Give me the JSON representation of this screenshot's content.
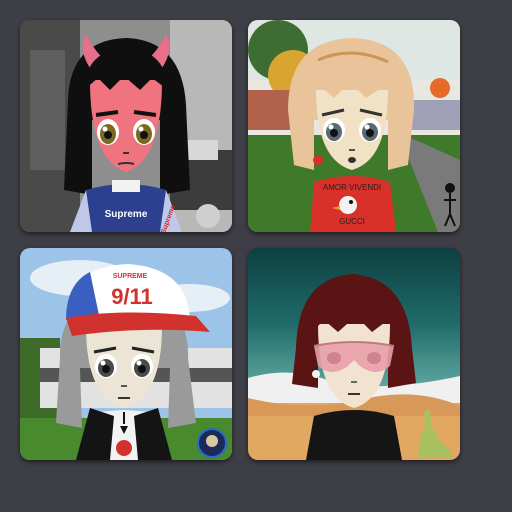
{
  "gallery": {
    "cards": [
      {
        "shirt_text": "Supreme",
        "sleeve_text": "Supreme",
        "palette": {
          "skin": "#f07480",
          "hair": "#0f0f0f",
          "horn": "#e86f8a",
          "eye": "#7a6a20",
          "shirt": "#2d3f8f",
          "background": "#9a9a9a"
        }
      },
      {
        "shirt_text": "AMOR VIVENDI",
        "shirt_sub": "GUCCI",
        "palette": {
          "skin": "#f1e2c6",
          "hair": "#e9c39a",
          "shirt": "#d9312a",
          "grass": "#3e7a2a",
          "sky": "#e8e8e0"
        }
      },
      {
        "cap_text": "9/11",
        "cap_top_text": "SUPREME",
        "palette": {
          "skin": "#ece4d4",
          "hair": "#9a9a9a",
          "cap_front": "#ffffff",
          "cap_back": "#3b5fc0",
          "brim": "#d2322d",
          "jacket": "#141414",
          "sky": "#9cc4e8",
          "grass": "#4a8a2e"
        }
      },
      {
        "shirt_text": "",
        "palette": {
          "skin": "#f2e2d0",
          "hair": "#5a1414",
          "glasses": "#e8a0a8",
          "shirt": "#151515",
          "sea": "#1f6b6a",
          "sand": "#e0a860"
        }
      }
    ]
  }
}
